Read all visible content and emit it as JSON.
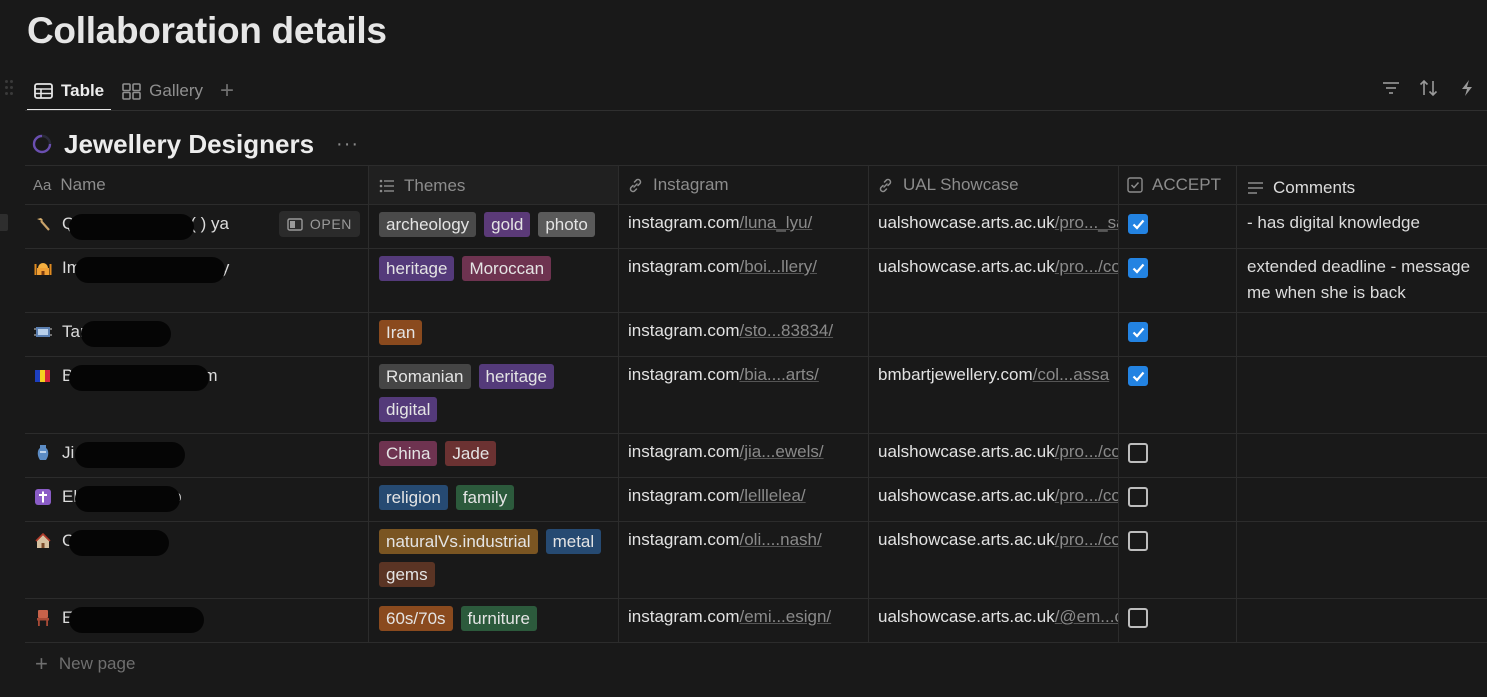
{
  "page_title": "Collaboration details",
  "tabs": [
    {
      "label": "Table",
      "active": true
    },
    {
      "label": "Gallery",
      "active": false
    }
  ],
  "toolbar_icons": [
    "filter-icon",
    "sort-icon",
    "automation-icon"
  ],
  "database": {
    "title": "Jewellery Designers",
    "more": "···"
  },
  "columns": {
    "name": {
      "icon": "Aa",
      "label": "Name"
    },
    "themes": {
      "label": "Themes"
    },
    "instagram": {
      "label": "Instagram"
    },
    "ual": {
      "label": "UAL Showcase"
    },
    "accept": {
      "label": "ACCEPT"
    },
    "comments": {
      "label": "Comments"
    }
  },
  "open_label": "OPEN",
  "rows": [
    {
      "emoji": "hammer",
      "name": "Q",
      "name_rest": "(      ) ya",
      "themes": [
        {
          "label": "archeology",
          "color": "#4a4a4a"
        },
        {
          "label": "gold",
          "color": "#5b3a78"
        },
        {
          "label": "photo",
          "color": "#5a5a5a"
        }
      ],
      "instagram_host": "instagram.com",
      "instagram_path": "/luna_lyu/",
      "ual_host": "ualshowcase.arts.ac.uk",
      "ual_path": "/pro..._sa",
      "accept": true,
      "comment": "- has digital knowledge"
    },
    {
      "emoji": "mosque",
      "name": "Im",
      "name_rest": "y",
      "themes": [
        {
          "label": "heritage",
          "color": "#543a7a"
        },
        {
          "label": "Moroccan",
          "color": "#6e3350"
        }
      ],
      "instagram_host": "instagram.com",
      "instagram_path": "/boi...llery/",
      "ual_host": "ualshowcase.arts.ac.uk",
      "ual_path": "/pro.../co",
      "accept": true,
      "comment": "extended deadline - message me when she is back"
    },
    {
      "emoji": "rug",
      "name": "Tan",
      "name_rest": "",
      "themes": [
        {
          "label": "Iran",
          "color": "#8a4a1e"
        }
      ],
      "instagram_host": "instagram.com",
      "instagram_path": "/sto...83834/",
      "ual_host": "",
      "ual_path": "",
      "accept": true,
      "comment": ""
    },
    {
      "emoji": "flag-romania",
      "name": "B",
      "name_rest": "m",
      "themes": [
        {
          "label": "Romanian",
          "color": "#454545"
        },
        {
          "label": "heritage",
          "color": "#543a7a"
        },
        {
          "label": "digital",
          "color": "#543a7a"
        }
      ],
      "instagram_host": "instagram.com",
      "instagram_path": "/bia....arts/",
      "ual_host": "bmbartjewellery.com",
      "ual_path": "/col...assa",
      "accept": true,
      "comment": ""
    },
    {
      "emoji": "vase",
      "name": "Ji",
      "name_rest": "o",
      "themes": [
        {
          "label": "China",
          "color": "#6e3350"
        },
        {
          "label": "Jade",
          "color": "#6b3232"
        }
      ],
      "instagram_host": "instagram.com",
      "instagram_path": "/jia...ewels/",
      "ual_host": "ualshowcase.arts.ac.uk",
      "ual_path": "/pro.../co",
      "accept": false,
      "comment": ""
    },
    {
      "emoji": "cross",
      "name": "El",
      "name_rest": "o",
      "themes": [
        {
          "label": "religion",
          "color": "#264a72"
        },
        {
          "label": "family",
          "color": "#2c5a3c"
        }
      ],
      "instagram_host": "instagram.com",
      "instagram_path": "/lelllelea/",
      "ual_host": "ualshowcase.arts.ac.uk",
      "ual_path": "/pro.../co",
      "accept": false,
      "comment": ""
    },
    {
      "emoji": "house",
      "name": "C",
      "name_rest": "",
      "themes": [
        {
          "label": "naturalVs.industrial",
          "color": "#7a5522"
        },
        {
          "label": "metal",
          "color": "#264a72"
        },
        {
          "label": "gems",
          "color": "#5a3424"
        }
      ],
      "instagram_host": "instagram.com",
      "instagram_path": "/oli....nash/",
      "ual_host": "ualshowcase.arts.ac.uk",
      "ual_path": "/pro.../co",
      "accept": false,
      "comment": ""
    },
    {
      "emoji": "chair",
      "name": "E",
      "name_rest": "",
      "themes": [
        {
          "label": "60s/70s",
          "color": "#8a4a1e"
        },
        {
          "label": "furniture",
          "color": "#2c5a3c"
        }
      ],
      "instagram_host": "instagram.com",
      "instagram_path": "/emi...esign/",
      "ual_host": "ualshowcase.arts.ac.uk",
      "ual_path": "/@em...c",
      "accept": false,
      "comment": ""
    }
  ],
  "new_page_label": "New page"
}
